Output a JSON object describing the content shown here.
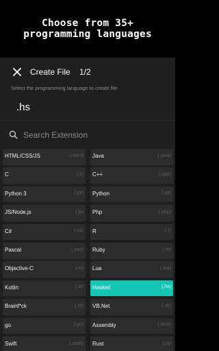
{
  "banner": {
    "line1": "Choose from 35+",
    "line2": "programming languages"
  },
  "dialog": {
    "title": "Create File",
    "step": "1/2",
    "subtitle": "Select the programming language to create file",
    "extension": ".hs"
  },
  "search": {
    "placeholder": "Search Extension",
    "value": ""
  },
  "languages": [
    {
      "name": "HTML/CSS/JS",
      "ext": "(.html)"
    },
    {
      "name": "Java",
      "ext": "(.java)"
    },
    {
      "name": "C",
      "ext": "(.c)"
    },
    {
      "name": "C++",
      "ext": "(.cpp)"
    },
    {
      "name": "Python 3",
      "ext": "(.py)"
    },
    {
      "name": "Python",
      "ext": "(.py)"
    },
    {
      "name": "JS/Node.js",
      "ext": "(.js)"
    },
    {
      "name": "Php",
      "ext": "(.php)"
    },
    {
      "name": "C#",
      "ext": "(.cs)"
    },
    {
      "name": "R",
      "ext": "(.r)"
    },
    {
      "name": "Pascal",
      "ext": "(.pas)"
    },
    {
      "name": "Ruby",
      "ext": "(.rb)"
    },
    {
      "name": "Objective-C",
      "ext": "(.m)"
    },
    {
      "name": "Lua",
      "ext": "(.lua)"
    },
    {
      "name": "Kotlin",
      "ext": "(.kt)"
    },
    {
      "name": "Haskell",
      "ext": "(.hs)",
      "selected": true
    },
    {
      "name": "Brainf*ck",
      "ext": "(.bf)"
    },
    {
      "name": "VB.Net",
      "ext": "(.vb)"
    },
    {
      "name": "go",
      "ext": "(.go)"
    },
    {
      "name": "Assembly",
      "ext": "(.asm)"
    },
    {
      "name": "Swift",
      "ext": "(.swift)"
    },
    {
      "name": "Rust",
      "ext": "(.rs)"
    }
  ],
  "icons": {
    "close": "close-icon",
    "search": "search-icon"
  },
  "colors": {
    "accent": "#14c7b4",
    "background": "#1f1f1f",
    "tile": "#2c2c2c"
  }
}
